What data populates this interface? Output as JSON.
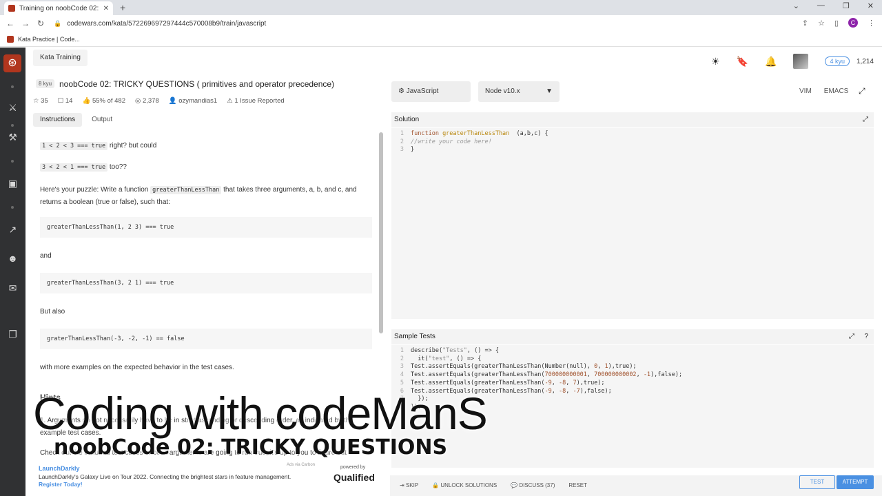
{
  "browser": {
    "tab_title": "Training on noobCode 02: TRICK",
    "url": "codewars.com/kata/572269697297444c570008b9/train/javascript",
    "bookmark": "Kata Practice | Code...",
    "avatar_letter": "C",
    "new_tab": "+",
    "close": "✕"
  },
  "header": {
    "kata_training": "Kata Training",
    "rank": "4 kyu",
    "honor": "1,214"
  },
  "kata": {
    "kyu": "8 kyu",
    "title": "noobCode 02: TRICKY QUESTIONS ( primitives and operator precedence)",
    "stats": {
      "stars": "35",
      "bookmarks": "14",
      "satisfaction": "55% of 482",
      "completed": "2,378",
      "author": "ozymandias1",
      "issues": "1 Issue Reported"
    },
    "tabs": [
      "Instructions",
      "Output"
    ]
  },
  "instructions": {
    "line1_code": "1 < 2 < 3 === true",
    "line1_text": " right? but could",
    "line2_code": "3 < 2 < 1 === true",
    "line2_text": " too??",
    "puzzle_a": "Here's your puzzle: Write a function ",
    "puzzle_code": "greaterThanLessThan",
    "puzzle_b": " that takes three arguments, a, b, and c, and",
    "puzzle_c": "returns a boolean (true or false), such that:",
    "block1": "greaterThanLessThan(1, 2 3) === true",
    "and": "and",
    "block2": "greaterThanLessThan(3, 2 1) === true",
    "but_also": "But also",
    "block3": "graterThanLessThan(-3, -2, -1) == false",
    "more": "with more examples on the expected behavior in the test cases.",
    "hints_title": "Hints",
    "hint1": "1.  Arguments do not necessarily have to be in strict ascending or descending order, as indicated by the example test cases.",
    "hint2": "Check out the included test cases - not all arguments are going to run true, it's up to you to figure out"
  },
  "ad": {
    "brand": "LaunchDarkly",
    "via": "Ads via Carbon",
    "text": "LaunchDarkly's Galaxy Live on Tour 2022. Connecting the brightest stars in feature management. ",
    "link": "Register Today!",
    "powered": "powered by",
    "qualified": "Qualified"
  },
  "editor": {
    "language": "JavaScript",
    "runtime": "Node v10.x",
    "modes": [
      "VIM",
      "EMACS"
    ],
    "solution_label": "Solution",
    "solution_lines": [
      {
        "n": "1",
        "parts": [
          [
            "kw",
            "function "
          ],
          [
            "fn",
            "greaterThanLessThan"
          ],
          [
            "",
            "  (a,b,c) {"
          ]
        ]
      },
      {
        "n": "2",
        "parts": [
          [
            "cm",
            "//write your code here!"
          ]
        ]
      },
      {
        "n": "3",
        "parts": [
          [
            "",
            "}"
          ]
        ]
      }
    ],
    "tests_label": "Sample Tests",
    "test_lines": [
      {
        "n": "1",
        "parts": [
          [
            "",
            "describe("
          ],
          [
            "str",
            "\"Tests\""
          ],
          [
            "",
            ", () => {"
          ]
        ]
      },
      {
        "n": "2",
        "parts": [
          [
            "",
            "  it("
          ],
          [
            "str",
            "\"test\""
          ],
          [
            "",
            ", () => {"
          ]
        ]
      },
      {
        "n": "3",
        "parts": [
          [
            "",
            "Test.assertEquals(greaterThanLessThan(Number(null), "
          ],
          [
            "num",
            "0"
          ],
          [
            "",
            ", "
          ],
          [
            "num",
            "1"
          ],
          [
            "",
            "),true);"
          ]
        ]
      },
      {
        "n": "4",
        "parts": [
          [
            "",
            "Test.assertEquals(greaterThanLessThan("
          ],
          [
            "num",
            "700000000001"
          ],
          [
            "",
            ", "
          ],
          [
            "num",
            "700000000002"
          ],
          [
            "",
            ", "
          ],
          [
            "num",
            "-1"
          ],
          [
            "",
            "),false);"
          ]
        ]
      },
      {
        "n": "5",
        "parts": [
          [
            "",
            "Test.assertEquals(greaterThanLessThan("
          ],
          [
            "num",
            "-9"
          ],
          [
            "",
            ", "
          ],
          [
            "num",
            "-8"
          ],
          [
            "",
            ", "
          ],
          [
            "num",
            "7"
          ],
          [
            "",
            "),true);"
          ]
        ]
      },
      {
        "n": "6",
        "parts": [
          [
            "",
            "Test.assertEquals(greaterThanLessThan("
          ],
          [
            "num",
            "-9"
          ],
          [
            "",
            ", "
          ],
          [
            "num",
            "-8"
          ],
          [
            "",
            ", "
          ],
          [
            "num",
            "-7"
          ],
          [
            "",
            "),false);"
          ]
        ]
      },
      {
        "n": "7",
        "parts": [
          [
            "",
            "  });"
          ]
        ]
      },
      {
        "n": "8",
        "parts": [
          [
            "",
            "});"
          ]
        ]
      }
    ]
  },
  "actions": {
    "skip": "SKIP",
    "unlock": "UNLOCK SOLUTIONS",
    "discuss": "DISCUSS (37)",
    "reset": "RESET",
    "test": "TEST",
    "attempt": "ATTEMPT"
  },
  "overlay": {
    "line1": "Coding with codeManS",
    "line2": "noobCode 02: TRICKY QUESTIONS"
  }
}
